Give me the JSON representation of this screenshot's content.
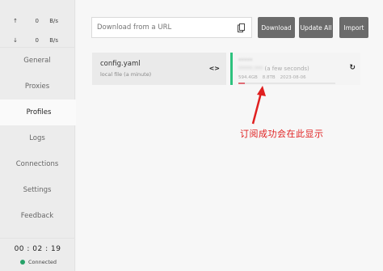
{
  "window": {
    "pin_glyph": "⚲",
    "minimize_glyph": "—",
    "close_glyph": "✕"
  },
  "traffic": {
    "up": {
      "arrow": "↑",
      "value": "0",
      "unit": "B/s"
    },
    "down": {
      "arrow": "↓",
      "value": "0",
      "unit": "B/s"
    }
  },
  "nav": {
    "general": "General",
    "proxies": "Proxies",
    "profiles": "Profiles",
    "logs": "Logs",
    "connections": "Connections",
    "settings": "Settings",
    "feedback": "Feedback"
  },
  "status": {
    "uptime": "00 : 02 : 19",
    "connection": "Connected",
    "connection_color": "#26a269"
  },
  "toolbar": {
    "url_placeholder": "Download from a URL",
    "download_label": "Download",
    "update_all_label": "Update All",
    "import_label": "Import"
  },
  "profiles": {
    "local": {
      "name": "config.yaml",
      "meta": "local file (a minute)",
      "action_icon": "<>"
    },
    "remote": {
      "name": "*****",
      "host_blurred": "*****.***",
      "updated": "(a few seconds)",
      "used": "594.4GB",
      "total": "8.8TB",
      "expires": "2023-08-06",
      "usage_fraction": 0.07,
      "accent": "#2ec27e"
    }
  },
  "annotation": {
    "text": "订阅成功会在此显示",
    "color": "#e02020"
  }
}
